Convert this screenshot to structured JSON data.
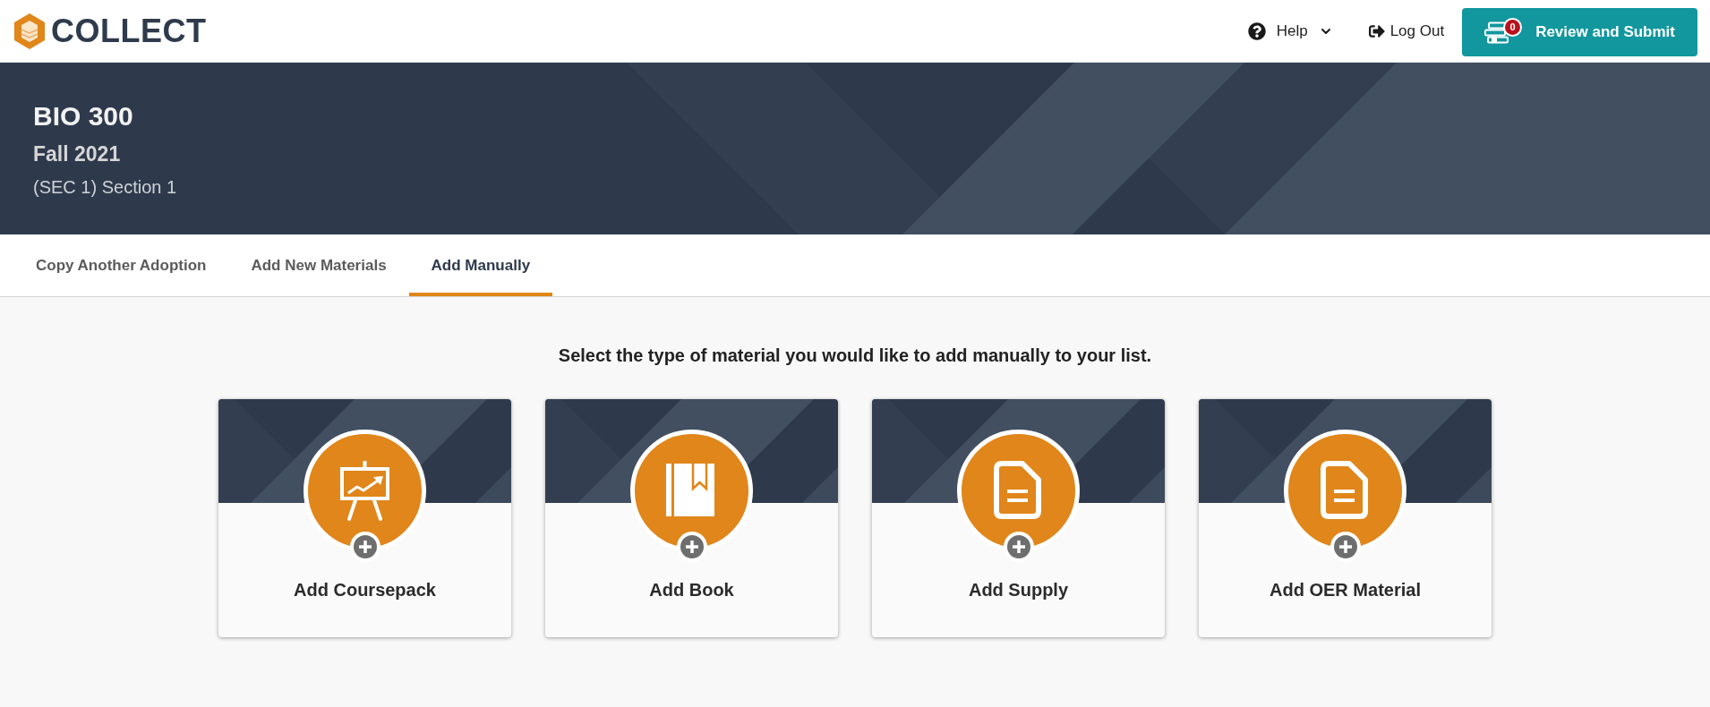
{
  "header": {
    "brand": "COLLECT",
    "help": {
      "label": "Help"
    },
    "logout": {
      "label": "Log Out"
    },
    "submit": {
      "label": "Review and Submit",
      "badge": "0"
    }
  },
  "course": {
    "title": "BIO 300",
    "term": "Fall 2021",
    "section": "(SEC 1) Section 1"
  },
  "tabs": [
    {
      "label": "Copy Another Adoption",
      "selected": false
    },
    {
      "label": "Add New Materials",
      "selected": false
    },
    {
      "label": "Add Manually",
      "selected": true
    }
  ],
  "main": {
    "prompt": "Select the type of material you would like to add manually to your list.",
    "cards": [
      {
        "kind": "coursepack",
        "label": "Add Coursepack"
      },
      {
        "kind": "book",
        "label": "Add Book"
      },
      {
        "kind": "supply",
        "label": "Add Supply"
      },
      {
        "kind": "oer",
        "label": "Add OER Material"
      }
    ]
  }
}
